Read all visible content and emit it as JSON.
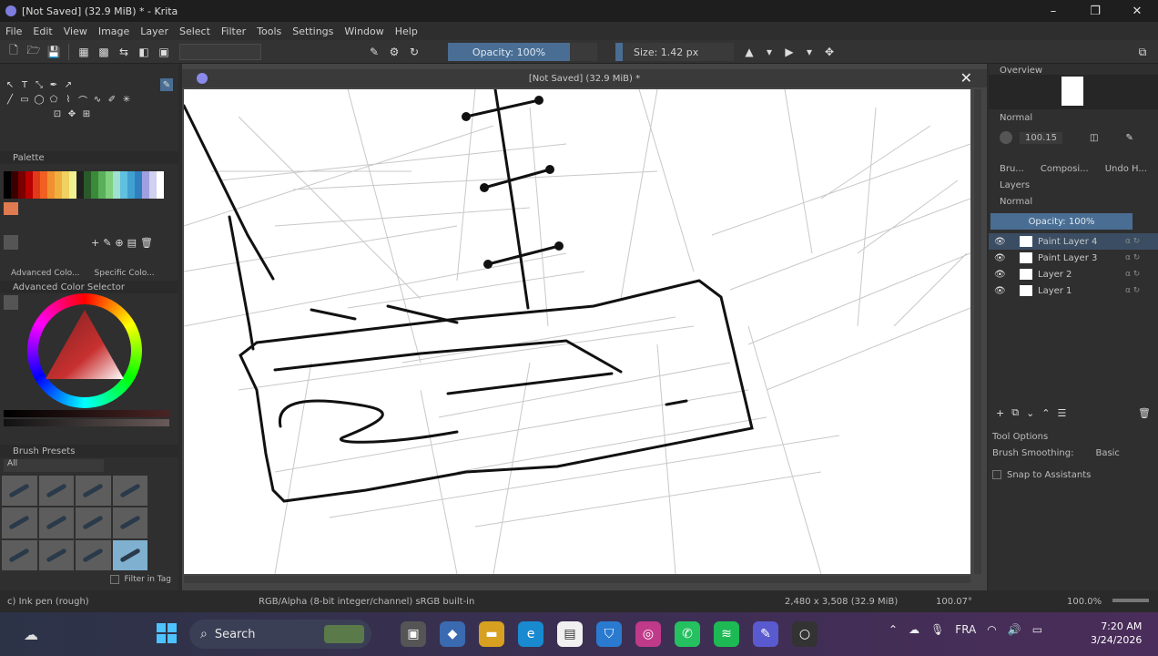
{
  "window": {
    "title": "[Not Saved] (32.9 MiB) * - Krita",
    "controls": [
      "minimize-icon",
      "restore-icon",
      "close-icon"
    ]
  },
  "menu": [
    "File",
    "Edit",
    "View",
    "Image",
    "Layer",
    "Select",
    "Filter",
    "Tools",
    "Settings",
    "Window",
    "Help"
  ],
  "toolbar": {
    "opacity_label": "Opacity: 100%",
    "opacity_value": 100,
    "size_label": "Size: 1.42 px"
  },
  "document_tab": {
    "title": "[Not Saved] (32.9 MiB) *"
  },
  "left_panels": {
    "palette_title": "Palette",
    "palette_colors": [
      "#000000",
      "#3a0000",
      "#7a0000",
      "#b80000",
      "#e03a1a",
      "#f06020",
      "#f09030",
      "#f0b040",
      "#f0d060",
      "#f0f090",
      "#202020",
      "#2a5a2a",
      "#3a8a3a",
      "#5ab05a",
      "#80d080",
      "#a0e0d0",
      "#60c0e0",
      "#40a0d0",
      "#3080c0",
      "#a0a0e0",
      "#d0d0f0",
      "#ffffff"
    ],
    "layers_mini_label": "Layers",
    "tabs": [
      "Advanced Colo...",
      "Specific Colo..."
    ],
    "advanced_color_title": "Advanced Color Selector",
    "brush_presets_title": "Brush Presets",
    "brush_tag": "All",
    "filter_in_tag": "Filter in Tag"
  },
  "right_panels": {
    "overview_title": "Overview",
    "blend_mode": "Normal",
    "angle_value": "100.15",
    "tabs": [
      "Bru...",
      "Composi...",
      "Undo H..."
    ],
    "layers_title": "Layers",
    "layers_blend": "Normal",
    "layers_opacity_label": "Opacity: 100%",
    "layers": [
      {
        "name": "Paint Layer 4",
        "active": true
      },
      {
        "name": "Paint Layer 3",
        "active": false
      },
      {
        "name": "Layer 2",
        "active": false
      },
      {
        "name": "Layer 1",
        "active": false
      }
    ],
    "tool_options_title": "Tool Options",
    "brush_smoothing_label": "Brush Smoothing:",
    "brush_smoothing_value": "Basic",
    "snap_label": "Snap to Assistants"
  },
  "status": {
    "brush": "c) Ink pen (rough)",
    "color_model": "RGB/Alpha (8-bit integer/channel)  sRGB built-in",
    "dimensions": "2,480 x 3,508 (32.9 MiB)",
    "rotation": "100.07°",
    "zoom": "100.0%"
  },
  "taskbar": {
    "search_placeholder": "Search",
    "language": "FRA",
    "time": "7:20 AM",
    "date": "3/24/2026"
  }
}
